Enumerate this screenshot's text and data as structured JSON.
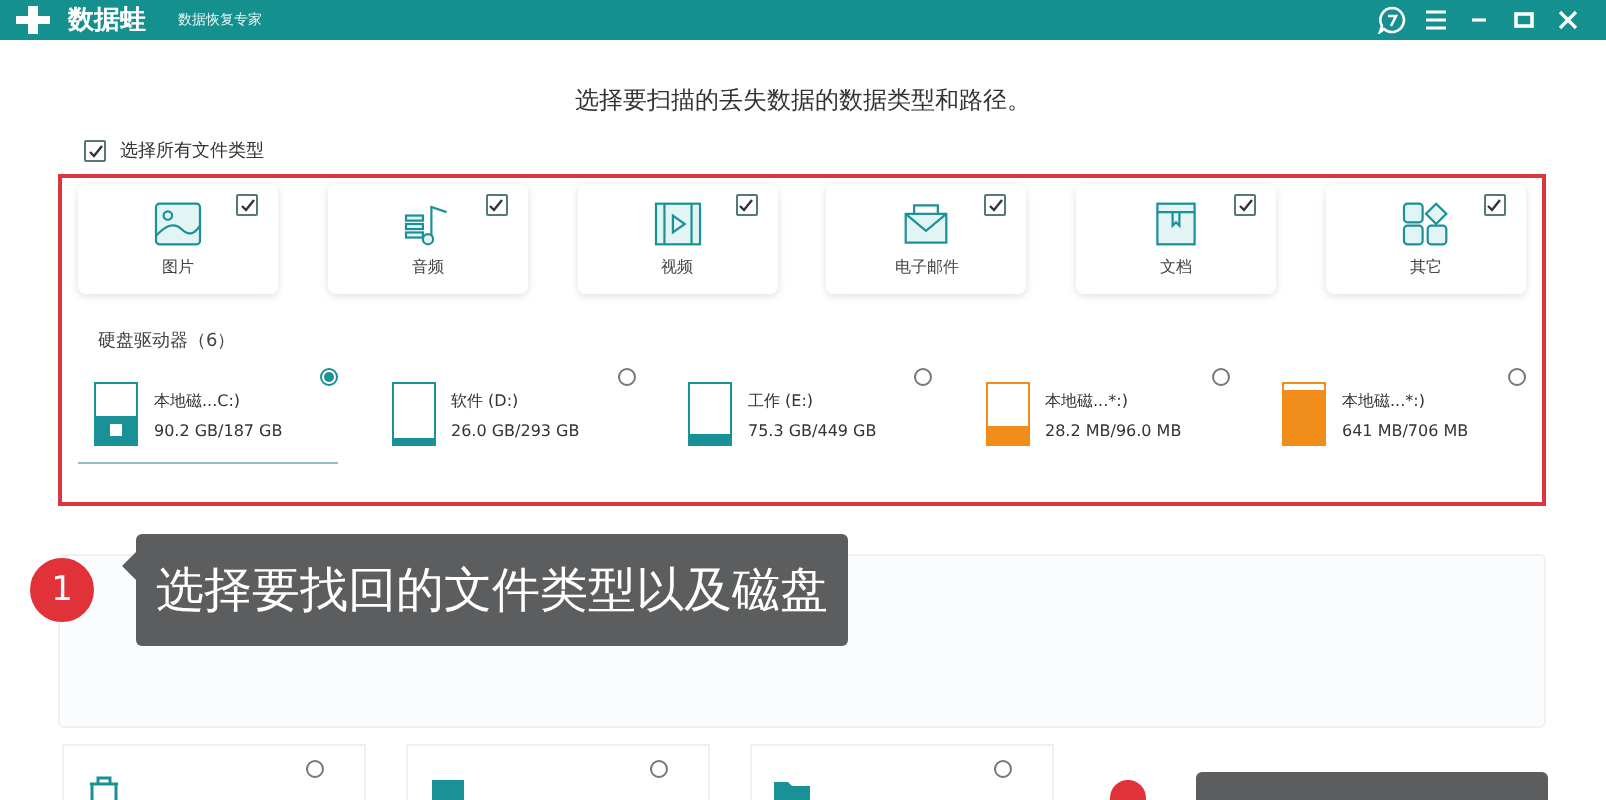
{
  "window": {
    "app_name": "数据蛙",
    "subtitle": "数据恢复专家"
  },
  "heading": "选择要扫描的丢失数据的数据类型和路径。",
  "select_all": {
    "label": "选择所有文件类型",
    "checked": true
  },
  "file_types": [
    {
      "kind": "image",
      "label": "图片",
      "checked": true
    },
    {
      "kind": "audio",
      "label": "音频",
      "checked": true
    },
    {
      "kind": "video",
      "label": "视频",
      "checked": true
    },
    {
      "kind": "email",
      "label": "电子邮件",
      "checked": true
    },
    {
      "kind": "document",
      "label": "文档",
      "checked": true
    },
    {
      "kind": "other",
      "label": "其它",
      "checked": true
    }
  ],
  "drives_title": "硬盘驱动器（6）",
  "drives": [
    {
      "name": "本地磁...C:)",
      "usage": "90.2 GB/187 GB",
      "level": 0.48,
      "color": "#1a9196",
      "system": true,
      "selected": true
    },
    {
      "name": "软件 (D:)",
      "usage": "26.0 GB/293 GB",
      "level": 0.09,
      "color": "#1a9196",
      "system": false,
      "selected": false
    },
    {
      "name": "工作 (E:)",
      "usage": "75.3 GB/449 GB",
      "level": 0.17,
      "color": "#1a9196",
      "system": false,
      "selected": false
    },
    {
      "name": "本地磁...*:)",
      "usage": "28.2 MB/96.0 MB",
      "level": 0.3,
      "color": "#ef8c1a",
      "system": false,
      "selected": false
    },
    {
      "name": "本地磁...*:)",
      "usage": "641 MB/706 MB",
      "level": 0.9,
      "color": "#ef8c1a",
      "system": false,
      "selected": false
    }
  ],
  "bottom_cards": [
    {
      "kind": "trash",
      "selected": false
    },
    {
      "kind": "desktop",
      "selected": false
    },
    {
      "kind": "folder",
      "selected": false
    }
  ],
  "callout": {
    "number": "1",
    "text": "选择要找回的文件类型以及磁盘"
  }
}
